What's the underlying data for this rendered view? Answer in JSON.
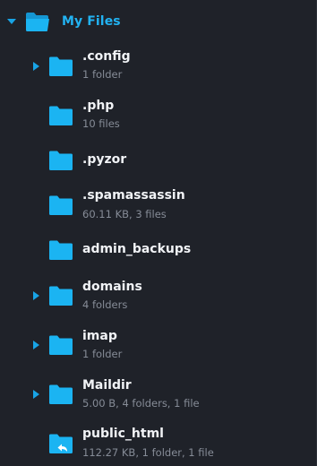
{
  "colors": {
    "background": "#1f2229",
    "accent": "#22b3f2",
    "folder": "#1bb4f2",
    "text": "#f1f3f6",
    "muted": "#868c97"
  },
  "root": {
    "label": "My Files",
    "expanded": true,
    "icon": "folder-open-icon"
  },
  "items": [
    {
      "name": ".config",
      "meta": "1 folder",
      "expandable": true,
      "icon": "folder-icon"
    },
    {
      "name": ".php",
      "meta": "10 files",
      "expandable": false,
      "icon": "folder-icon"
    },
    {
      "name": ".pyzor",
      "meta": "",
      "expandable": false,
      "icon": "folder-icon"
    },
    {
      "name": ".spamassassin",
      "meta": "60.11 KB, 3 files",
      "expandable": false,
      "icon": "folder-icon"
    },
    {
      "name": "admin_backups",
      "meta": "",
      "expandable": false,
      "icon": "folder-icon"
    },
    {
      "name": "domains",
      "meta": "4 folders",
      "expandable": true,
      "icon": "folder-icon"
    },
    {
      "name": "imap",
      "meta": "1 folder",
      "expandable": true,
      "icon": "folder-icon"
    },
    {
      "name": "Maildir",
      "meta": "5.00 B, 4 folders, 1 file",
      "expandable": true,
      "icon": "folder-icon"
    },
    {
      "name": "public_html",
      "meta": "112.27 KB, 1 folder, 1 file",
      "expandable": false,
      "icon": "folder-shared-icon"
    }
  ]
}
